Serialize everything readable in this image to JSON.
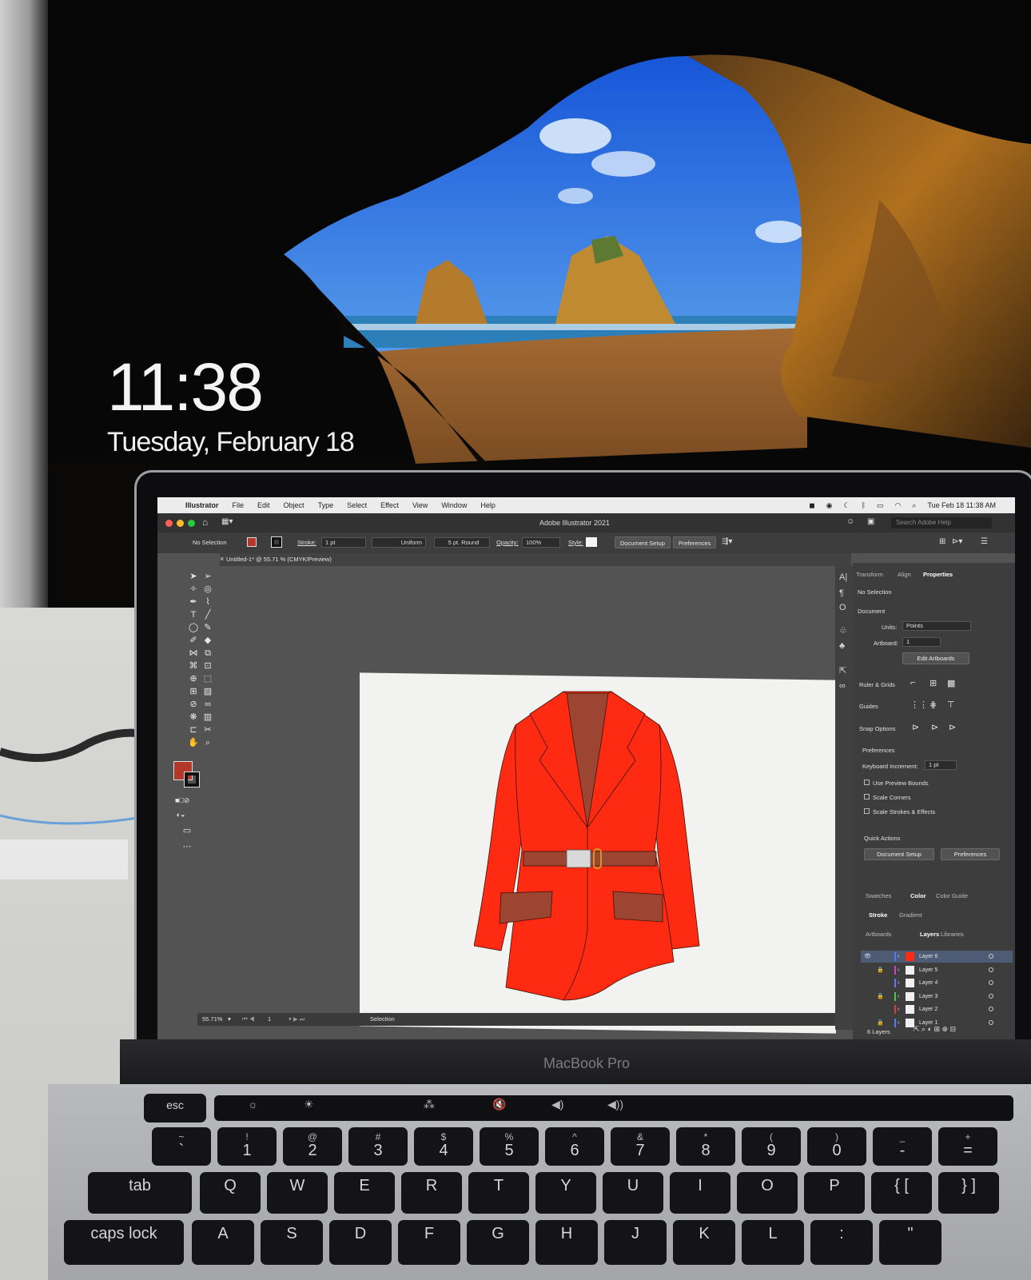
{
  "lock_screen": {
    "time": "11:38",
    "date": "Tuesday, February 18"
  },
  "mac_menubar": {
    "app_name": "Illustrator",
    "menus": [
      "File",
      "Edit",
      "Object",
      "Type",
      "Select",
      "Effect",
      "View",
      "Window",
      "Help"
    ],
    "clock": "Tue Feb 18  11:38 AM"
  },
  "window": {
    "title": "Adobe Illustrator 2021",
    "search_placeholder": "Search Adobe Help"
  },
  "control_bar": {
    "selection_state": "No Selection",
    "stroke_label": "Stroke:",
    "stroke_value": "1 pt",
    "profile": "Uniform",
    "brush": "5 pt. Round",
    "opacity_label": "Opacity:",
    "opacity_value": "100%",
    "style_label": "Style:",
    "document_setup": "Document Setup",
    "preferences": "Preferences"
  },
  "document_tab": "Untitled-1* @ 55.71 % (CMYK/Preview)",
  "status_bar": {
    "zoom": "55.71%",
    "artboard": "1",
    "tool": "Selection"
  },
  "properties_panel": {
    "tabs": [
      "Transform",
      "Align",
      "Properties"
    ],
    "active_tab": "Properties",
    "selection": "No Selection",
    "document_heading": "Document",
    "units_label": "Units:",
    "units_value": "Points",
    "artboard_label": "Artboard:",
    "artboard_value": "1",
    "edit_artboards": "Edit Artboards",
    "rulers_grids": "Ruler & Grids",
    "guides": "Guides",
    "snap_options": "Snap Options",
    "preferences_heading": "Preferences",
    "keyboard_increment_label": "Keyboard Increment:",
    "keyboard_increment_value": "1 pt",
    "use_preview_bounds": "Use Preview Bounds",
    "scale_corners": "Scale Corners",
    "scale_strokes": "Scale Strokes & Effects",
    "quick_actions": "Quick Actions",
    "qa_document_setup": "Document Setup",
    "qa_preferences": "Preferences"
  },
  "color_panel_tabs": [
    "Swatches",
    "Color",
    "Color Guide"
  ],
  "color_panel_subtabs": [
    "Stroke",
    "Gradient"
  ],
  "layers_panel": {
    "tabs": [
      "Artboards",
      "Layers",
      "Libraries"
    ],
    "layers": [
      {
        "name": "Layer 6",
        "color": "#4f7fff",
        "visible": true,
        "locked": false,
        "active": true
      },
      {
        "name": "Layer 5",
        "color": "#d23cd2",
        "visible": false,
        "locked": true,
        "active": false
      },
      {
        "name": "Layer 4",
        "color": "#4f7fff",
        "visible": false,
        "locked": false,
        "active": false
      },
      {
        "name": "Layer 3",
        "color": "#3cd23c",
        "visible": false,
        "locked": true,
        "active": false
      },
      {
        "name": "Layer 2",
        "color": "#e03c3c",
        "visible": false,
        "locked": false,
        "active": false
      },
      {
        "name": "Layer 1",
        "color": "#4f7fff",
        "visible": false,
        "locked": true,
        "active": false
      }
    ],
    "count": "6 Layers"
  },
  "laptop_brand": "MacBook Pro",
  "keyboard": {
    "row1": [
      {
        "top": "~",
        "main": "`"
      },
      {
        "top": "!",
        "main": "1"
      },
      {
        "top": "@",
        "main": "2"
      },
      {
        "top": "#",
        "main": "3"
      },
      {
        "top": "$",
        "main": "4"
      },
      {
        "top": "%",
        "main": "5"
      },
      {
        "top": "^",
        "main": "6"
      },
      {
        "top": "&",
        "main": "7"
      },
      {
        "top": "*",
        "main": "8"
      },
      {
        "top": "(",
        "main": "9"
      },
      {
        "top": ")",
        "main": "0"
      },
      {
        "top": "_",
        "main": "-"
      },
      {
        "top": "+",
        "main": "="
      }
    ],
    "row2": [
      "tab",
      "Q",
      "W",
      "E",
      "R",
      "T",
      "Y",
      "U",
      "I",
      "O",
      "P",
      "{ [",
      "} ]"
    ],
    "row3": [
      "caps lock",
      "A",
      "S",
      "D",
      "F",
      "G",
      "H",
      "J",
      "K",
      "L",
      ":",
      "\""
    ],
    "esc": "esc"
  },
  "colors": {
    "jacket": "#fe2a12",
    "trim": "#9c4533",
    "buckle": "#d9d9d9",
    "accent_blue": "#4f7fff"
  }
}
